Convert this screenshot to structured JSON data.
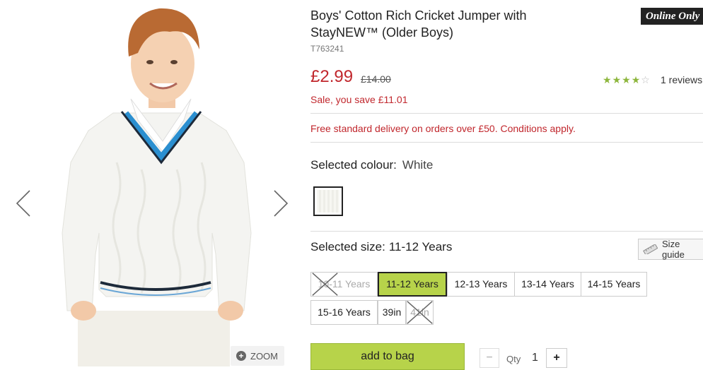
{
  "product": {
    "title": "Boys' Cotton Rich Cricket Jumper with StayNEW™ (Older Boys)",
    "code": "T763241",
    "badge": "Online Only",
    "price": "£2.99",
    "was_price": "£14.00",
    "saving": "Sale, you save £11.01",
    "rating": 4,
    "rating_max": 5,
    "reviews": "1 reviews",
    "delivery": "Free standard delivery on orders over £50. Conditions apply."
  },
  "colour": {
    "label": "Selected colour:",
    "value": "White"
  },
  "size": {
    "label": "Selected size:",
    "value": "11-12 Years",
    "guide": "Size guide",
    "options": [
      {
        "label": "10-11 Years",
        "available": false,
        "selected": false
      },
      {
        "label": "11-12 Years",
        "available": true,
        "selected": true
      },
      {
        "label": "12-13 Years",
        "available": true,
        "selected": false
      },
      {
        "label": "13-14 Years",
        "available": true,
        "selected": false
      },
      {
        "label": "14-15 Years",
        "available": true,
        "selected": false
      },
      {
        "label": "15-16 Years",
        "available": true,
        "selected": false
      },
      {
        "label": "39in",
        "available": true,
        "selected": false
      },
      {
        "label": "41in",
        "available": false,
        "selected": false
      }
    ]
  },
  "gallery": {
    "zoom": "ZOOM"
  },
  "cart": {
    "add_label": "add to bag",
    "qty_label": "Qty",
    "qty_value": "1",
    "minus": "−",
    "plus": "+"
  },
  "colors": {
    "accent_red": "#c1272d",
    "button_green": "#b7d34a",
    "star_green": "#8db63c",
    "jumper_blue": "#2b8fd0"
  }
}
